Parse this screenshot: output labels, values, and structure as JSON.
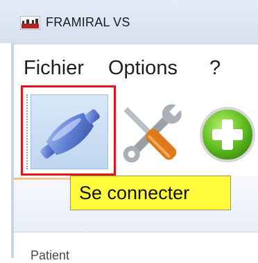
{
  "window": {
    "title": "FRAMIRAL VS",
    "icon": "app-logo-icon"
  },
  "menu": {
    "items": [
      "Fichier",
      "Options",
      "?"
    ]
  },
  "toolbar": {
    "buttons": [
      {
        "name": "connect",
        "icon": "plug-connector-icon"
      },
      {
        "name": "tools",
        "icon": "wrench-screwdriver-icon"
      },
      {
        "name": "add",
        "icon": "green-plus-icon"
      }
    ]
  },
  "tooltip": {
    "text": "Se connecter",
    "color": "#fffb3c"
  },
  "highlight": {
    "color": "#e8131a"
  },
  "footer": {
    "label": "Patient"
  }
}
